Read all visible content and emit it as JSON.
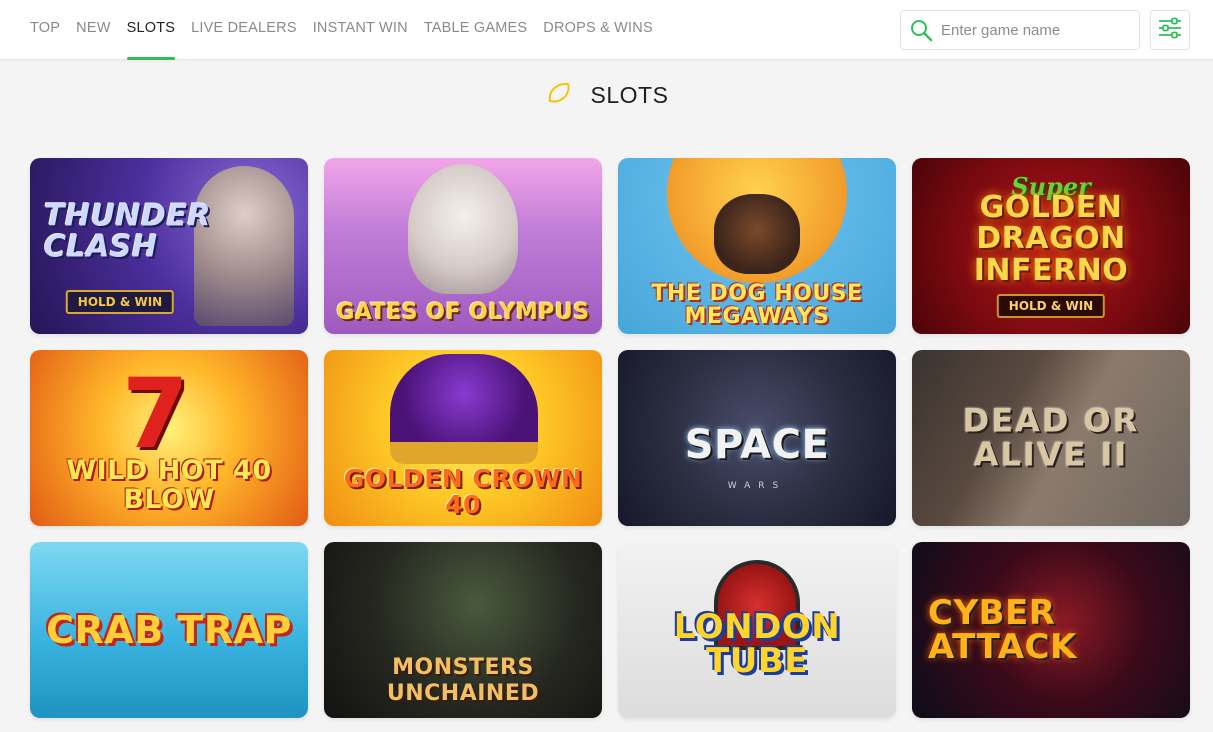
{
  "nav": {
    "tabs": [
      {
        "label": "TOP"
      },
      {
        "label": "NEW"
      },
      {
        "label": "SLOTS"
      },
      {
        "label": "LIVE DEALERS"
      },
      {
        "label": "INSTANT WIN"
      },
      {
        "label": "TABLE GAMES"
      },
      {
        "label": "DROPS & WINS"
      }
    ],
    "active_tab": "SLOTS"
  },
  "search": {
    "placeholder": "Enter game name",
    "value": "",
    "icon": "search-icon"
  },
  "filter": {
    "icon": "sliders-icon"
  },
  "section": {
    "icon": "lemon-icon",
    "title": "SLOTS"
  },
  "colors": {
    "accent": "#2fbf5a",
    "heading_icon": "#f2c40f",
    "background": "#f4f4f4"
  },
  "games": [
    {
      "title": "THUNDER CLASH",
      "badge": "HOLD & WIN"
    },
    {
      "title": "GATES of OLYMPUS"
    },
    {
      "title": "THE DOG HOUSE MEGAWAYS"
    },
    {
      "title_top": "Super",
      "title": "GOLDEN DRAGON INFERNO",
      "badge": "HOLD & WIN"
    },
    {
      "title": "WILD HOT 40 BLOW",
      "deco": "7"
    },
    {
      "title": "GOLDEN CROWN 40"
    },
    {
      "title": "SPACE",
      "subtitle": "WARS"
    },
    {
      "title": "DEAD OR ALIVE II"
    },
    {
      "title": "CRAB TRAP"
    },
    {
      "title": "MONSTERS UNCHAINED"
    },
    {
      "title": "LONDON TUBE"
    },
    {
      "title": "CYBER ATTACK"
    }
  ]
}
